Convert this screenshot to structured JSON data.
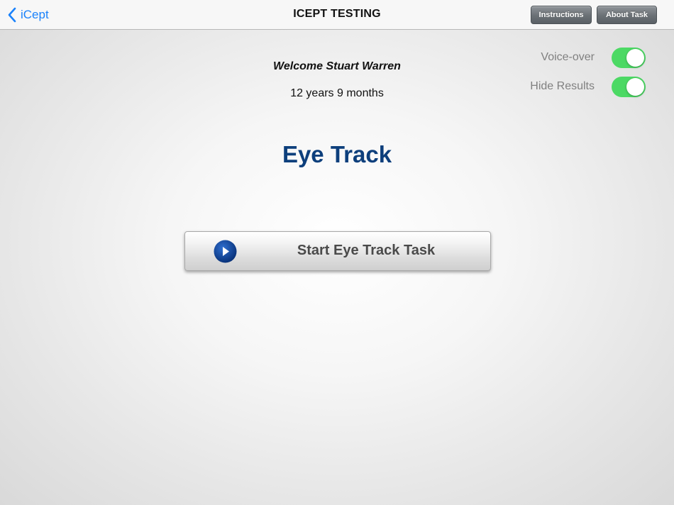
{
  "navbar": {
    "back_label": "iCept",
    "title": "ICEPT TESTING",
    "instructions_label": "Instructions",
    "about_label": "About Task"
  },
  "user": {
    "welcome": "Welcome Stuart Warren",
    "age": "12 years 9 months"
  },
  "settings": {
    "voice_over": {
      "label": "Voice-over",
      "on": true
    },
    "hide_results": {
      "label": "Hide Results",
      "on": true
    }
  },
  "task": {
    "title": "Eye Track",
    "start_label": "Start Eye Track Task"
  },
  "colors": {
    "accent": "#1a82fb",
    "title": "#0d3f7c",
    "toggle_on": "#4cd964",
    "play_icon": "#0a4ba8"
  },
  "icons": {
    "back": "chevron-left-icon",
    "start": "play-circle-icon"
  }
}
